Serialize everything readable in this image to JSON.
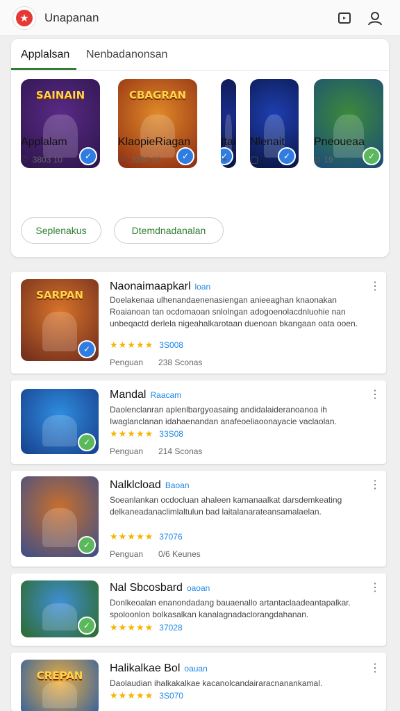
{
  "header": {
    "title": "Unapanan",
    "logo_icon": "star-logo-icon",
    "actions": [
      {
        "name": "cast-icon"
      },
      {
        "name": "account-icon"
      }
    ]
  },
  "tabs": [
    {
      "label": "Applalsan",
      "active": true
    },
    {
      "label": "Nenbadanonsan",
      "active": false
    }
  ],
  "featured": [
    {
      "name": "Applalam",
      "meta": "3803 10",
      "meta_icon": "heart-icon",
      "art_text": "SAINAIN",
      "badge": "check-badge",
      "colors": [
        "#5a2a86",
        "#2b144a"
      ]
    },
    {
      "name": "KlaopieRiagan",
      "meta": "3280 10",
      "meta_icon": "thumb-up-icon",
      "art_text": "CBAGRAN",
      "badge": "check-badge",
      "colors": [
        "#e08a28",
        "#8c2a12"
      ]
    },
    {
      "name": "Itai",
      "meta": "",
      "meta_icon": "pin-icon",
      "art_text": "",
      "badge": "check-badge",
      "colors": [
        "#1a2c8a",
        "#0b1340"
      ]
    },
    {
      "name": "Nlenait",
      "meta": "",
      "meta_icon": "image-icon",
      "art_text": "",
      "badge": "check-badge",
      "colors": [
        "#1e3fb3",
        "#0a1540"
      ]
    },
    {
      "name": "Pneoueaa",
      "meta": "19",
      "meta_icon": "gallery-icon",
      "art_text": "",
      "badge": "green-badge",
      "colors": [
        "#3b8a3a",
        "#1b4a7a"
      ]
    }
  ],
  "buttons": {
    "primary": "Seplenakus",
    "secondary": "Dtemdnadanalan"
  },
  "apps": [
    {
      "title": "Naonaimaapkarl",
      "subtitle": "loan",
      "description": "Doelakenaa ulhenandaenenasiengan anieeaghan knaonakan Roaianoan tan ocdomaoan snlolngan adogoenolacdnluohie nan unbeqactd derlela nigeahalkarotaan duenoan bkangaan oata ooen.",
      "rating": "★★★★★",
      "score": "3S008",
      "footer": [
        "Penguan",
        "238 Sconas"
      ],
      "art_text": "SARPAN",
      "colors": [
        "#d9742a",
        "#6b2a1c"
      ],
      "badge": "check-badge"
    },
    {
      "title": "Mandal",
      "subtitle": "Raacam",
      "description": "Daolenclanran aplenlbargyoasaing andidalaideranoanoa ih Iwaglanclanan idahaenandan anafeoeliaoonayacie vaclaolan.",
      "rating": "★★★★★",
      "score": "33S08",
      "footer": [
        "Penguan",
        "214 Sconas"
      ],
      "art_text": "",
      "colors": [
        "#2f8de0",
        "#173f8a"
      ],
      "badge": "green-badge"
    },
    {
      "title": "Nalklcload",
      "subtitle": "Baoan",
      "description": "Soeanlankan ocdocluan ahaleen kamanaalkat darsdemkeating delkaneadanaclimlaltulun bad laitalanarateansamalaelan.",
      "rating": "★★★★★",
      "score": "37076",
      "footer": [
        "Penguan",
        "0/6 Keunes"
      ],
      "art_text": "",
      "colors": [
        "#c9702d",
        "#3a4e8a"
      ],
      "badge": "green-badge"
    },
    {
      "title": "Nal Sbcosbard",
      "subtitle": "oaoan",
      "description": "Donlkeoalan enanondadang bauaenallo artantaclaadeantapalkar. spoloonlon bolkasalkan kanalagnadaclorangdahanan.",
      "rating": "★★★★★",
      "score": "37028",
      "footer": [],
      "art_text": "",
      "colors": [
        "#3f8fd6",
        "#2e6a2a"
      ],
      "badge": "green-badge"
    },
    {
      "title": "Halikalkae Bol",
      "subtitle": "oauan",
      "description": "Daolaudian ihalkakalkae kacanolcandairaracnanankamal.",
      "rating": "★★★★★",
      "score": "3S070",
      "footer": [],
      "art_text": "CREPAN",
      "colors": [
        "#f0b040",
        "#3060a0"
      ],
      "badge": ""
    }
  ]
}
